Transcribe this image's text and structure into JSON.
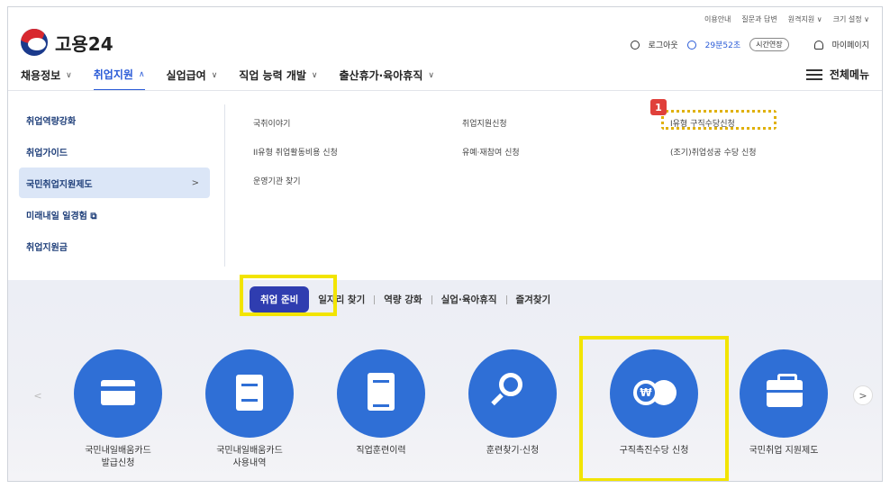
{
  "utility": [
    "이용안내",
    "질문과 답변",
    "원격지원 ∨",
    "크기 설정 ∨"
  ],
  "logo": {
    "text": "고용24"
  },
  "session": {
    "logout": "로그아웃",
    "timer": "29분52초",
    "extend": "시간연장",
    "mypage": "마이페이지"
  },
  "nav": [
    {
      "label": "채용정보",
      "chev": "∨"
    },
    {
      "label": "취업지원",
      "chev": "∧"
    },
    {
      "label": "실업급여",
      "chev": "∨"
    },
    {
      "label": "직업 능력 개발",
      "chev": "∨"
    },
    {
      "label": "출산휴가·육아휴직",
      "chev": "∨"
    }
  ],
  "allmenu": "전체메뉴",
  "sidebar": [
    "취업역량강화",
    "취업가이드",
    "국민취업지원제도",
    "미래내일 일경험 ⧉",
    "취업지원금"
  ],
  "sidebar_arrow": ">",
  "submenu": {
    "col1": [
      "국취이야기",
      "II유형 취업활동비용 신청",
      "운영기관 찾기"
    ],
    "col2": [
      "취업지원신청",
      "유예·재참여 신청"
    ],
    "col3": [
      "I유형 구직수당신청",
      "(조기)취업성공 수당 신청"
    ]
  },
  "badge": "1",
  "tabs": [
    "취업 준비",
    "일자리 찾기",
    "역량 강화",
    "실업·육아휴직",
    "즐겨찾기"
  ],
  "cards": [
    {
      "label": "국민내일배움카드\n발급신청",
      "icon": "card-icon"
    },
    {
      "label": "국민내일배움카드\n사용내역",
      "icon": "scroll-icon"
    },
    {
      "label": "직업훈련이력",
      "icon": "document-icon"
    },
    {
      "label": "훈련찾기·신청",
      "icon": "magnifier-icon"
    },
    {
      "label": "구직촉진수당 신청",
      "icon": "coin-icon"
    },
    {
      "label": "국민취업 지원제도",
      "icon": "briefcase-icon"
    }
  ],
  "coin_symbol": "₩",
  "arrows": {
    "prev": "<",
    "next": ">"
  },
  "colors": {
    "accent": "#2a5bd7",
    "circle": "#2f6fd6",
    "tab_active": "#2f3db0",
    "highlight": "#f2e400",
    "badge": "#e0403b"
  }
}
